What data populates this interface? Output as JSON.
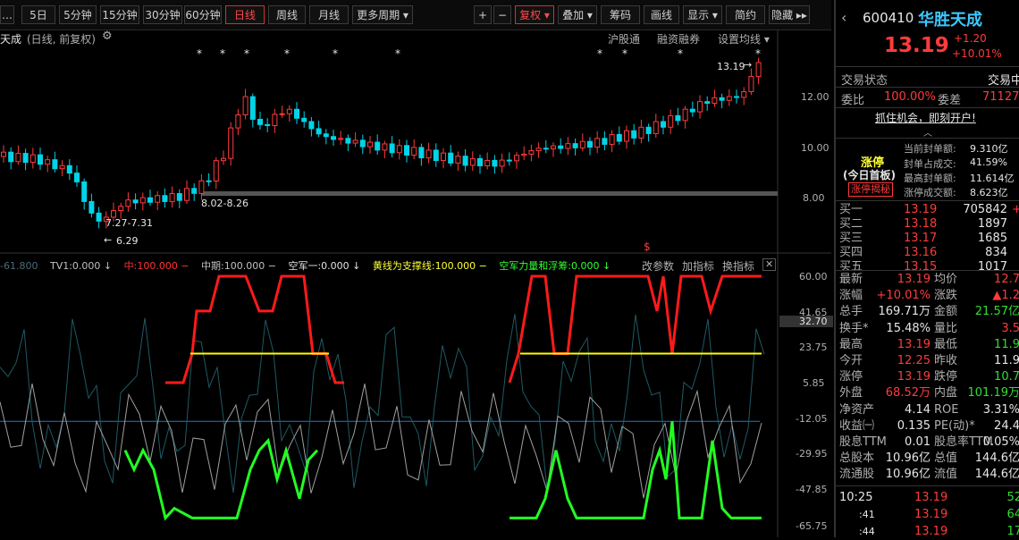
{
  "toolbar": {
    "left_items": [
      "5日",
      "5分钟",
      "15分钟",
      "30分钟",
      "60分钟",
      "日线",
      "周线",
      "月线",
      "更多周期 ▾"
    ],
    "right_items": [
      "+",
      "−",
      "复权 ▾",
      "叠加 ▾",
      "筹码",
      "画线",
      "显示 ▾",
      "简约",
      "隐藏 ▸▸"
    ]
  },
  "chart": {
    "title": "天成",
    "subtitle": "(日线, 前复权)",
    "links": [
      "沪股通",
      "融资融券",
      "设置均线 ▾"
    ],
    "price_axis": [
      "12.00",
      "10.00",
      "8.00"
    ],
    "indicator_axis": [
      "60.00",
      "41.65",
      "32.70",
      "23.75",
      "5.85",
      "-12.05",
      "-29.95",
      "-47.85",
      "-65.75"
    ],
    "high_label": "13.19",
    "low_label": "6.29",
    "range1": "7.27-7.31",
    "range2": "8.02-8.26",
    "dollar_mark": "$",
    "legend": [
      {
        "text": "-61.800",
        "color": "#4a6a7a"
      },
      {
        "text": "TV1:0.000 ↓",
        "color": "#c0c0c0"
      },
      {
        "text": "中:100.000 −",
        "color": "#ff3333"
      },
      {
        "text": "中期:100.000 −",
        "color": "#c0c0c0"
      },
      {
        "text": "空军一:0.000 ↓",
        "color": "#e0e0e0"
      },
      {
        "text": "黄线为支撑线:100.000 −",
        "color": "#ffff33"
      },
      {
        "text": "空军力量和浮筹:0.000 ↓",
        "color": "#33ff33"
      }
    ],
    "legend_links": [
      "改参数",
      "加指标",
      "换指标",
      "✕"
    ],
    "stars": [
      "*",
      "*",
      "*",
      "*",
      "*",
      "*",
      "*",
      "*",
      "*",
      "*"
    ],
    "colors": {
      "up": "#ff3b3b",
      "down": "#00d4e8",
      "red_line": "#ff1a1a",
      "yellow_line": "#ffff00",
      "green_line": "#22ff22",
      "blue_line": "#1e78c8",
      "teal_line": "#1e5a64",
      "gray_line": "#a0a0a0"
    }
  },
  "panel": {
    "code": "600410",
    "name": "华胜天成",
    "price": "13.19",
    "change": "+1.20",
    "change_pct": "+10.01%",
    "status_label": "交易状态",
    "status_value": "交易中",
    "weibi_label": "委比",
    "weibi_value": "100.00%",
    "weicha_label": "委差",
    "weicha_value": "71127",
    "promo": "抓住机会，即刻开户!",
    "limit_title": "涨停",
    "limit_sub": "(今日首板)",
    "limit_btn": "涨停揭秘",
    "limit_stats": [
      {
        "label": "当前封单额:",
        "value": "9.310亿"
      },
      {
        "label": "封单占成交:",
        "value": "41.59%"
      },
      {
        "label": "最高封单额:",
        "value": "11.614亿"
      },
      {
        "label": "涨停成交额:",
        "value": "8.623亿"
      }
    ],
    "book": [
      {
        "label": "买一",
        "price": "13.19",
        "vol": "705842",
        "extra": "+"
      },
      {
        "label": "买二",
        "price": "13.18",
        "vol": "1897",
        "extra": ""
      },
      {
        "label": "买三",
        "price": "13.17",
        "vol": "1685",
        "extra": ""
      },
      {
        "label": "买四",
        "price": "13.16",
        "vol": "834",
        "extra": ""
      },
      {
        "label": "买五",
        "price": "13.15",
        "vol": "1017",
        "extra": ""
      }
    ],
    "stats": [
      {
        "l1": "最新",
        "v1": "13.19",
        "c1": "red",
        "l2": "均价",
        "v2": "12.7",
        "c2": "red"
      },
      {
        "l1": "涨幅",
        "v1": "+10.01%",
        "c1": "red",
        "l2": "涨跌",
        "v2": "▲1.2",
        "c2": "red"
      },
      {
        "l1": "总手",
        "v1": "169.71万",
        "c1": "white",
        "l2": "金额",
        "v2": "21.57亿",
        "c2": "green"
      },
      {
        "l1": "换手*",
        "v1": "15.48%",
        "c1": "white",
        "l2": "量比",
        "v2": "3.5",
        "c2": "red"
      },
      {
        "l1": "最高",
        "v1": "13.19",
        "c1": "red",
        "l2": "最低",
        "v2": "11.9",
        "c2": "green"
      },
      {
        "l1": "今开",
        "v1": "12.25",
        "c1": "red",
        "l2": "昨收",
        "v2": "11.9",
        "c2": "white"
      },
      {
        "l1": "涨停",
        "v1": "13.19",
        "c1": "red",
        "l2": "跌停",
        "v2": "10.7",
        "c2": "green"
      },
      {
        "l1": "外盘",
        "v1": "68.52万",
        "c1": "red",
        "l2": "内盘",
        "v2": "101.19万",
        "c2": "green"
      },
      {
        "l1": "净资产",
        "v1": "4.14",
        "c1": "white",
        "l2": "ROE",
        "v2": "3.31%",
        "c2": "white"
      },
      {
        "l1": "收益㈠",
        "v1": "0.135",
        "c1": "white",
        "l2": "PE(动)*",
        "v2": "24.4",
        "c2": "white"
      },
      {
        "l1": "股息TTM",
        "v1": "0.01",
        "c1": "white",
        "l2": "股息率TTM",
        "v2": "0.05%",
        "c2": "white"
      },
      {
        "l1": "总股本",
        "v1": "10.96亿",
        "c1": "white",
        "l2": "总值",
        "v2": "144.6亿",
        "c2": "white"
      },
      {
        "l1": "流通股",
        "v1": "10.96亿",
        "c1": "white",
        "l2": "流值",
        "v2": "144.6亿",
        "c2": "white"
      }
    ],
    "ticks": [
      {
        "time": "10:25",
        "price": "13.19",
        "vol": "52"
      },
      {
        "time": ":41",
        "price": "13.19",
        "vol": "64"
      },
      {
        "time": ":44",
        "price": "13.19",
        "vol": "17"
      }
    ]
  }
}
